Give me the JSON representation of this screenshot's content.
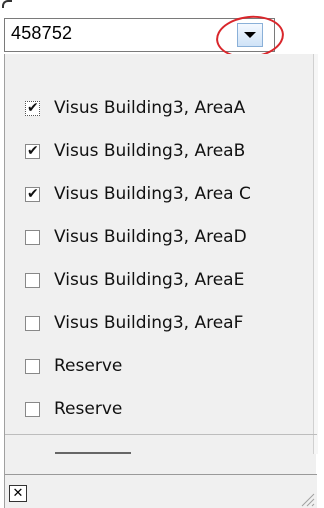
{
  "combo": {
    "value": "458752",
    "dropdown_icon": "chevron-down-icon"
  },
  "list": {
    "items": [
      {
        "label": "Visus Building3, AreaA",
        "checked": true
      },
      {
        "label": "Visus Building3, AreaB",
        "checked": true
      },
      {
        "label": "Visus Building3, Area C",
        "checked": true
      },
      {
        "label": "Visus Building3, AreaD",
        "checked": false
      },
      {
        "label": "Visus Building3, AreaE",
        "checked": false
      },
      {
        "label": "Visus Building3, AreaF",
        "checked": false
      },
      {
        "label": "Reserve",
        "checked": false
      },
      {
        "label": "Reserve",
        "checked": false
      }
    ]
  },
  "footer": {
    "close_icon": "close-icon",
    "close_symbol": "✕",
    "grip_icon": "resize-grip-icon"
  },
  "colors": {
    "highlight_circle": "#d9262b",
    "panel_background": "#f0f0f0",
    "button_gradient_top": "#f4f9ff",
    "button_gradient_bottom": "#cfe3f7"
  }
}
